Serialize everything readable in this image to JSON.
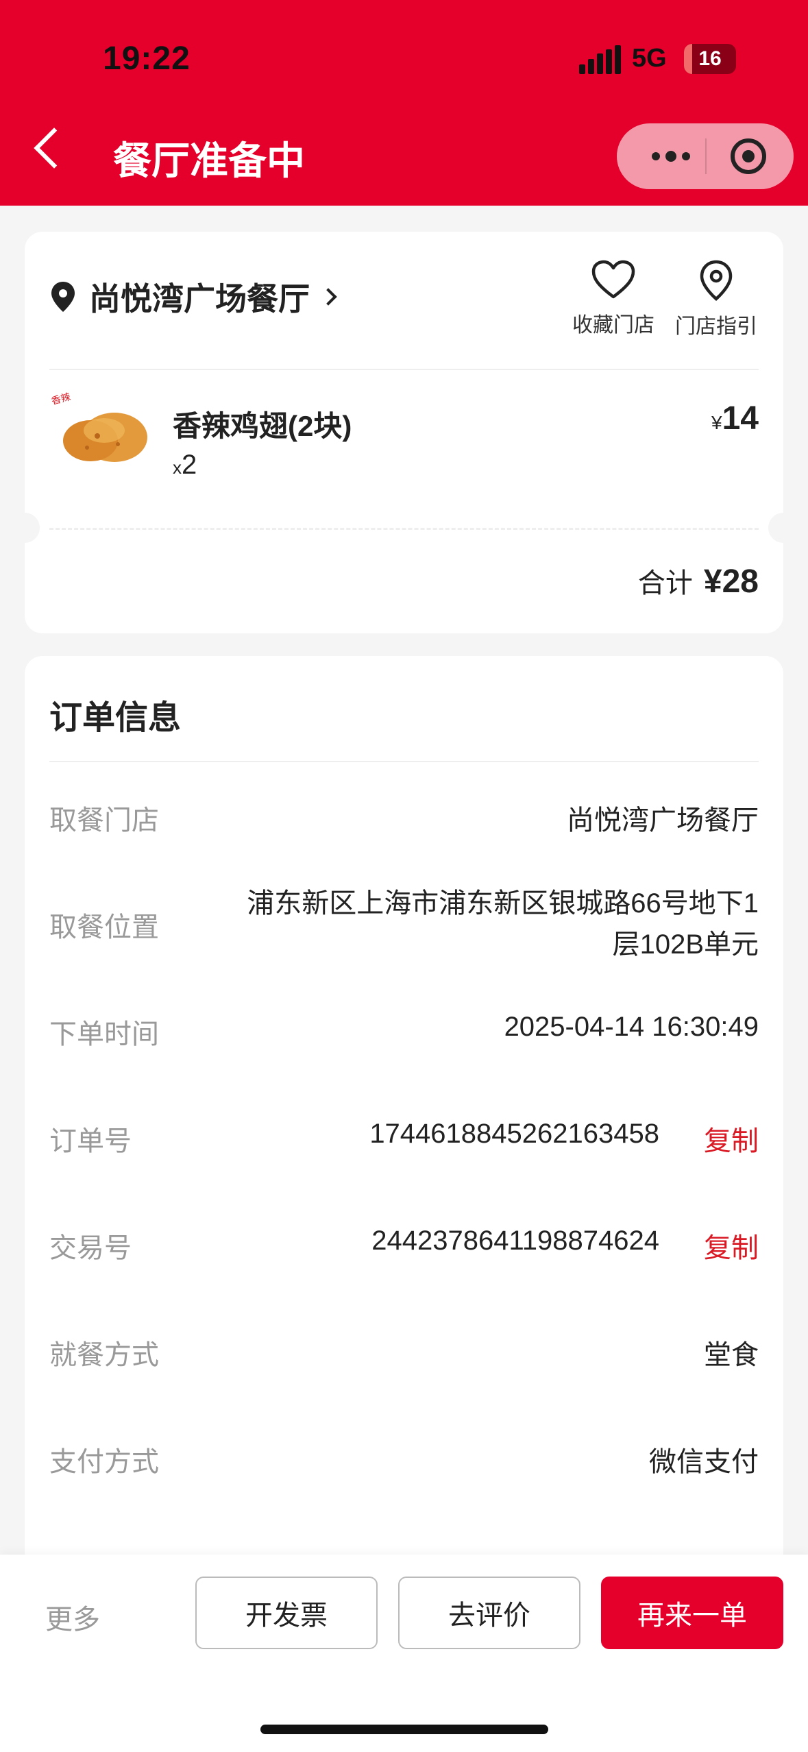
{
  "status_bar": {
    "time": "19:22",
    "network": "5G",
    "battery": "16",
    "battery_level": 0.16
  },
  "nav": {
    "title": "餐厅准备中",
    "icons": [
      "back-arrow-icon",
      "more-dots-icon",
      "close-target-icon"
    ]
  },
  "store_card": {
    "store_name": "尚悦湾广场餐厅",
    "favorite_label": "收藏门店",
    "guide_label": "门店指引",
    "item": {
      "name": "香辣鸡翅(2块)",
      "qty_prefix": "x",
      "qty": "2",
      "currency": "¥",
      "price": "14"
    },
    "total_label": "合计",
    "total_value": "¥28"
  },
  "order_info": {
    "title": "订单信息",
    "pickup_store_label": "取餐门店",
    "pickup_store_value": "尚悦湾广场餐厅",
    "pickup_location_label": "取餐位置",
    "pickup_location_value": "浦东新区上海市浦东新区银城路66号地下1层102B单元",
    "order_time_label": "下单时间",
    "order_time_value": "2025-04-14 16:30:49",
    "order_no_label": "订单号",
    "order_no_value": "1744618845262163458",
    "transaction_no_label": "交易号",
    "transaction_no_value": "2442378641198874624",
    "copy_label": "复制",
    "dining_label": "就餐方式",
    "dining_value": "堂食",
    "payment_label": "支付方式",
    "payment_value": "微信支付"
  },
  "bottom_bar": {
    "more": "更多",
    "invoice": "开发票",
    "review": "去评价",
    "reorder": "再来一单"
  },
  "colors": {
    "brand_red": "#e4002b",
    "copy_red": "#d91a24",
    "label_gray": "#999999",
    "page_bg": "#f5f5f5"
  }
}
